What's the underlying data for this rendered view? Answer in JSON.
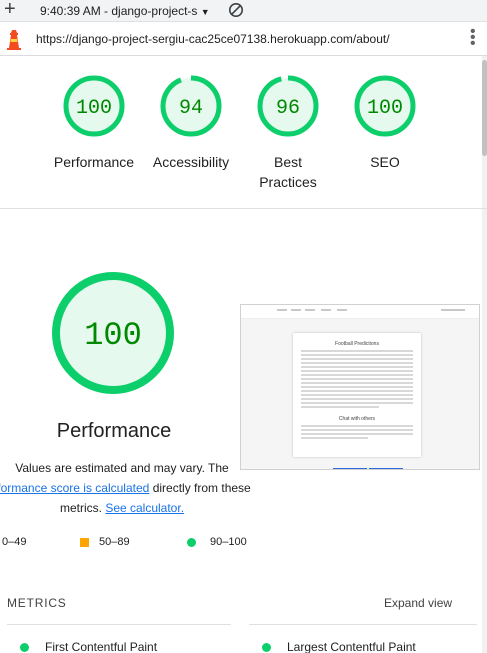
{
  "browser": {
    "tab_title": "9:40:39 AM - django-project-s",
    "url": "https://django-project-sergiu-cac25ce07138.herokuapp.com/about/"
  },
  "summary_gauges": [
    {
      "label": "Performance",
      "score": "100",
      "value": 100
    },
    {
      "label": "Accessibility",
      "score": "94",
      "value": 94
    },
    {
      "label": "Best Practices",
      "score": "96",
      "value": 96
    },
    {
      "label": "SEO",
      "score": "100",
      "value": 100
    }
  ],
  "performance": {
    "score": "100",
    "value": 100,
    "title": "Performance",
    "desc_part1": "Values are estimated and may vary. The",
    "desc_link1": "rformance score is calculated",
    "desc_part2": "directly from these metrics.",
    "desc_link2": "See calculator."
  },
  "screenshot_thumb": {
    "heading": "Football Predictions",
    "subheading": "Chat with others"
  },
  "legend": [
    {
      "range": "0–49",
      "kind": "fail"
    },
    {
      "range": "50–89",
      "kind": "average"
    },
    {
      "range": "90–100",
      "kind": "pass"
    }
  ],
  "metrics": {
    "title": "METRICS",
    "expand_label": "Expand view",
    "items": [
      {
        "label": "First Contentful Paint"
      },
      {
        "label": "Largest Contentful Paint"
      }
    ]
  },
  "colors": {
    "pass": "#0cce6b",
    "pass_text": "#008800",
    "pass_bg": "#e5f9ee",
    "average": "#ffa400",
    "link": "#1a73e8"
  },
  "icons": [
    "plus-icon",
    "dropdown-arrow-icon",
    "blocked-icon",
    "lighthouse-icon",
    "kebab-menu-icon"
  ]
}
